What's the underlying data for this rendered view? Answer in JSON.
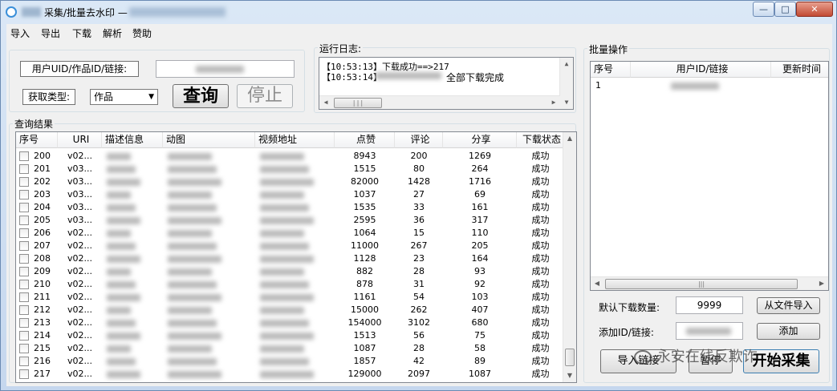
{
  "window": {
    "title": "采集/批量去水印 —",
    "controls": {
      "minimize": "—",
      "maximize": "□",
      "close": "✕"
    }
  },
  "menu": [
    "导入",
    "导出",
    "下载",
    "解析",
    "赞助"
  ],
  "query": {
    "uid_label": "用户UID/作品ID/链接:",
    "type_label": "获取类型:",
    "type_value": "作品",
    "query_button": "查询",
    "stop_button": "停止"
  },
  "log": {
    "title": "运行日志:",
    "lines": [
      "【10:53:13】下载成功==>217",
      "【10:53:14】",
      "全部下载完成"
    ]
  },
  "results": {
    "title": "查询结果",
    "columns": [
      "序号",
      "URI",
      "描述信息",
      "动图",
      "视频地址",
      "点赞",
      "评论",
      "分享",
      "下载状态"
    ],
    "rows": [
      {
        "id": "200",
        "uri": "v02...",
        "likes": "8943",
        "comments": "200",
        "shares": "1269",
        "status": "成功"
      },
      {
        "id": "201",
        "uri": "v03...",
        "likes": "1515",
        "comments": "80",
        "shares": "264",
        "status": "成功"
      },
      {
        "id": "202",
        "uri": "v03...",
        "likes": "82000",
        "comments": "1428",
        "shares": "1716",
        "status": "成功"
      },
      {
        "id": "203",
        "uri": "v03...",
        "likes": "1037",
        "comments": "27",
        "shares": "69",
        "status": "成功"
      },
      {
        "id": "204",
        "uri": "v03...",
        "likes": "1535",
        "comments": "33",
        "shares": "161",
        "status": "成功"
      },
      {
        "id": "205",
        "uri": "v03...",
        "likes": "2595",
        "comments": "36",
        "shares": "317",
        "status": "成功"
      },
      {
        "id": "206",
        "uri": "v02...",
        "likes": "1064",
        "comments": "15",
        "shares": "110",
        "status": "成功"
      },
      {
        "id": "207",
        "uri": "v02...",
        "likes": "11000",
        "comments": "267",
        "shares": "205",
        "status": "成功"
      },
      {
        "id": "208",
        "uri": "v02...",
        "likes": "1128",
        "comments": "23",
        "shares": "164",
        "status": "成功"
      },
      {
        "id": "209",
        "uri": "v02...",
        "likes": "882",
        "comments": "28",
        "shares": "93",
        "status": "成功"
      },
      {
        "id": "210",
        "uri": "v02...",
        "likes": "878",
        "comments": "31",
        "shares": "92",
        "status": "成功"
      },
      {
        "id": "211",
        "uri": "v02...",
        "likes": "1161",
        "comments": "54",
        "shares": "103",
        "status": "成功"
      },
      {
        "id": "212",
        "uri": "v02...",
        "likes": "15000",
        "comments": "262",
        "shares": "407",
        "status": "成功"
      },
      {
        "id": "213",
        "uri": "v02...",
        "likes": "154000",
        "comments": "3102",
        "shares": "680",
        "status": "成功"
      },
      {
        "id": "214",
        "uri": "v02...",
        "likes": "1513",
        "comments": "56",
        "shares": "75",
        "status": "成功"
      },
      {
        "id": "215",
        "uri": "v02...",
        "likes": "1087",
        "comments": "28",
        "shares": "58",
        "status": "成功"
      },
      {
        "id": "216",
        "uri": "v02...",
        "likes": "1857",
        "comments": "42",
        "shares": "89",
        "status": "成功"
      },
      {
        "id": "217",
        "uri": "v02...",
        "likes": "129000",
        "comments": "2097",
        "shares": "1087",
        "status": "成功"
      }
    ]
  },
  "batch": {
    "title": "批量操作",
    "columns": [
      "序号",
      "用户ID/链接",
      "更新时间"
    ],
    "rows": [
      {
        "id": "1"
      }
    ],
    "default_count_label": "默认下载数量:",
    "default_count_value": "9999",
    "import_file_button": "从文件导入",
    "add_id_label": "添加ID/链接:",
    "add_button": "添加",
    "import_link_button": "导入链接",
    "pause_button": "暂停",
    "start_button": "开始采集"
  },
  "watermark": {
    "text": "永安在线反欺诈"
  }
}
